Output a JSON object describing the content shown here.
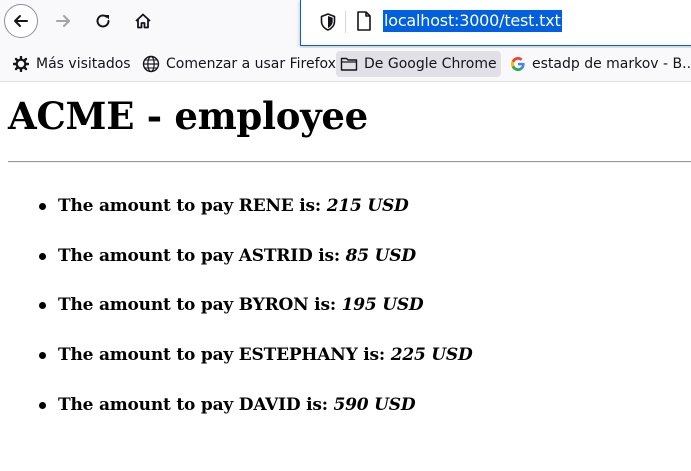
{
  "browser": {
    "url": "localhost:3000/test.txt",
    "bookmarks": [
      {
        "label": "Más visitados",
        "icon": "gear-icon"
      },
      {
        "label": "Comenzar a usar Firefox",
        "icon": "globe-icon"
      },
      {
        "label": "De Google Chrome",
        "icon": "folder-icon"
      },
      {
        "label": "estadp de markov - B...",
        "icon": "google-icon"
      }
    ]
  },
  "page": {
    "title": "ACME - employee",
    "items": [
      {
        "text": "The amount to pay RENE is: ",
        "amount": "215 USD"
      },
      {
        "text": "The amount to pay ASTRID is: ",
        "amount": "85 USD"
      },
      {
        "text": "The amount to pay BYRON is: ",
        "amount": "195 USD"
      },
      {
        "text": "The amount to pay ESTEPHANY is: ",
        "amount": "225 USD"
      },
      {
        "text": "The amount to pay DAVID is: ",
        "amount": "590 USD"
      }
    ]
  },
  "colors": {
    "url_highlight": "#0060df",
    "urlbar_focus_border": "#0061e0",
    "toolbar_bg": "#f9f9fb"
  }
}
